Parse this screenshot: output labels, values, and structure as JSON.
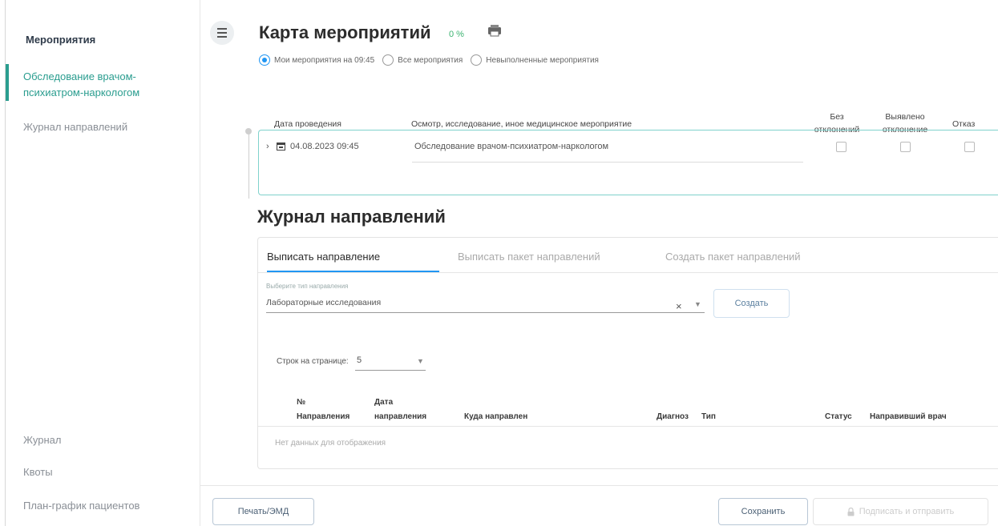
{
  "sidebar": {
    "header": "Мероприятия",
    "items": [
      {
        "label": "Обследование врачом-",
        "label2": "психиатром-наркологом",
        "active": true
      },
      {
        "label": "Журнал направлений"
      },
      {
        "label": "Журнал"
      },
      {
        "label": "Квоты"
      },
      {
        "label": "План-график пациентов"
      }
    ]
  },
  "header": {
    "title": "Карта мероприятий",
    "percent": "0 %",
    "filters": [
      {
        "label": "Мои мероприятия на 09:45",
        "checked": true
      },
      {
        "label": "Все мероприятия",
        "checked": false
      },
      {
        "label": "Невыполненные мероприятия",
        "checked": false
      }
    ]
  },
  "events": {
    "columns": {
      "date": "Дата проведения",
      "name": "Осмотр, исследование, иное медицинское мероприятие",
      "no_dev_1": "Без",
      "no_dev_2": "отклонений",
      "dev_1": "Выявлено",
      "dev_2": "отклонение",
      "refusal": "Отказ"
    },
    "rows": [
      {
        "date": "04.08.2023 09:45",
        "name": "Обследование врачом-психиатром-наркологом"
      }
    ]
  },
  "journal": {
    "title": "Журнал направлений",
    "tabs": [
      "Выписать направление",
      "Выписать пакет направлений",
      "Создать пакет направлений"
    ],
    "select_label": "Выберите тип направления",
    "select_value": "Лабораторные исследования",
    "create_label": "Создать",
    "rows_label": "Строк на странице:",
    "rows_value": "5",
    "columns": {
      "num_1": "№",
      "num_2": "Направления",
      "date_1": "Дата",
      "date_2": "направления",
      "dest": "Куда направлен",
      "diag": "Диагноз",
      "type": "Тип",
      "status": "Статус",
      "doctor": "Направивший врач"
    },
    "empty": "Нет данных для отображения"
  },
  "footer": {
    "print": "Печать/ЭМД",
    "save": "Сохранить",
    "sign": "Подписать и отправить"
  },
  "colors": {
    "accent": "#2a9d8f",
    "primary": "#2196f3"
  }
}
